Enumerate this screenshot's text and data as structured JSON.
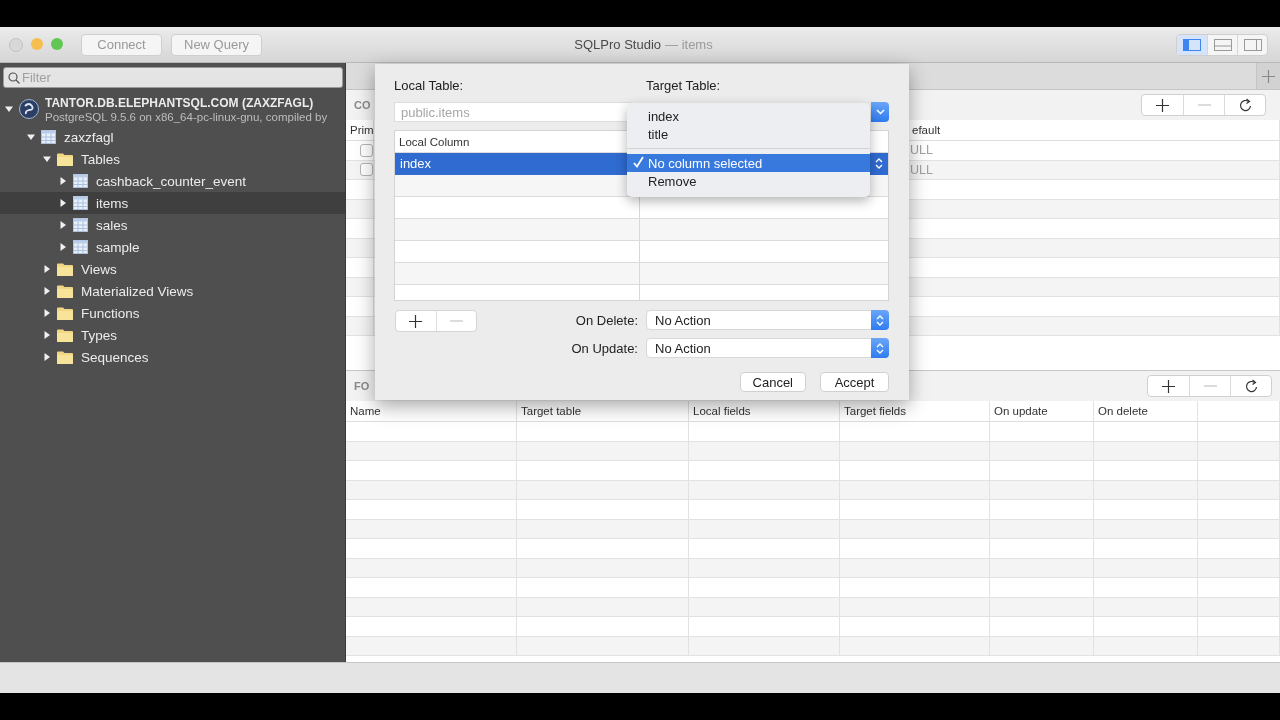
{
  "window": {
    "title": "SQLPro Studio",
    "document": "— items"
  },
  "toolbar": {
    "buttons": [
      "Connect",
      "New Query"
    ],
    "view_toggles": [
      {
        "on": true
      },
      {
        "on": false
      },
      {
        "on": false
      }
    ]
  },
  "sidebar": {
    "search": {
      "placeholder": "Filter"
    },
    "tree": [
      {
        "label": "TANTOR.DB.ELEPHANTSQL.COM (ZAXZFAGL)",
        "detail": "PostgreSQL 9.5.6 on x86_64-pc-linux-gnu, compiled by",
        "kind": "server",
        "expanded": true,
        "selected": false,
        "children": [
          {
            "label": "zaxzfagl",
            "kind": "database",
            "expanded": true,
            "selected": false,
            "children": [
              {
                "label": "Tables",
                "kind": "folder",
                "expanded": true,
                "selected": false,
                "children": [
                  {
                    "label": "cashback_counter_event",
                    "kind": "table",
                    "expanded": false,
                    "selected": false
                  },
                  {
                    "label": "items",
                    "kind": "table",
                    "expanded": false,
                    "selected": true
                  },
                  {
                    "label": "sales",
                    "kind": "table",
                    "expanded": false,
                    "selected": false
                  },
                  {
                    "label": "sample",
                    "kind": "table",
                    "expanded": false,
                    "selected": false
                  }
                ]
              },
              {
                "label": "Views",
                "kind": "folder",
                "expanded": false,
                "selected": false
              },
              {
                "label": "Materialized Views",
                "kind": "folder",
                "expanded": false,
                "selected": false
              },
              {
                "label": "Functions",
                "kind": "folder",
                "expanded": false,
                "selected": false
              },
              {
                "label": "Types",
                "kind": "folder",
                "expanded": false,
                "selected": false
              },
              {
                "label": "Sequences",
                "kind": "folder",
                "expanded": false,
                "selected": false
              }
            ]
          }
        ]
      }
    ]
  },
  "columns_section": {
    "title": "CO",
    "headers": [
      "Prim",
      "efault"
    ],
    "rows": [
      {
        "checked": false,
        "default": "ULL"
      },
      {
        "checked": false,
        "default": "ULL"
      }
    ]
  },
  "foreign_keys_section": {
    "title": "FO",
    "columns": [
      "Name",
      "Target table",
      "Local fields",
      "Target fields",
      "On update",
      "On delete"
    ]
  },
  "dialog": {
    "local_table_label": "Local Table:",
    "local_table": "public.items",
    "target_table_label": "Target Table:",
    "mapping_header": "Local Column",
    "mappings": [
      {
        "local": "index",
        "selected": true
      }
    ],
    "on_delete_label": "On Delete:",
    "on_delete": "No Action",
    "on_update_label": "On Update:",
    "on_update": "No Action",
    "buttons": [
      "Cancel",
      "Accept"
    ]
  },
  "popup_menu": {
    "sections": [
      {
        "items": [
          {
            "label": "index",
            "checked": false,
            "selected": false
          },
          {
            "label": "title",
            "checked": false,
            "selected": false
          }
        ]
      },
      {
        "items": [
          {
            "label": "No column selected",
            "checked": true,
            "selected": true
          },
          {
            "label": "Remove",
            "checked": false,
            "selected": false
          }
        ]
      }
    ]
  }
}
